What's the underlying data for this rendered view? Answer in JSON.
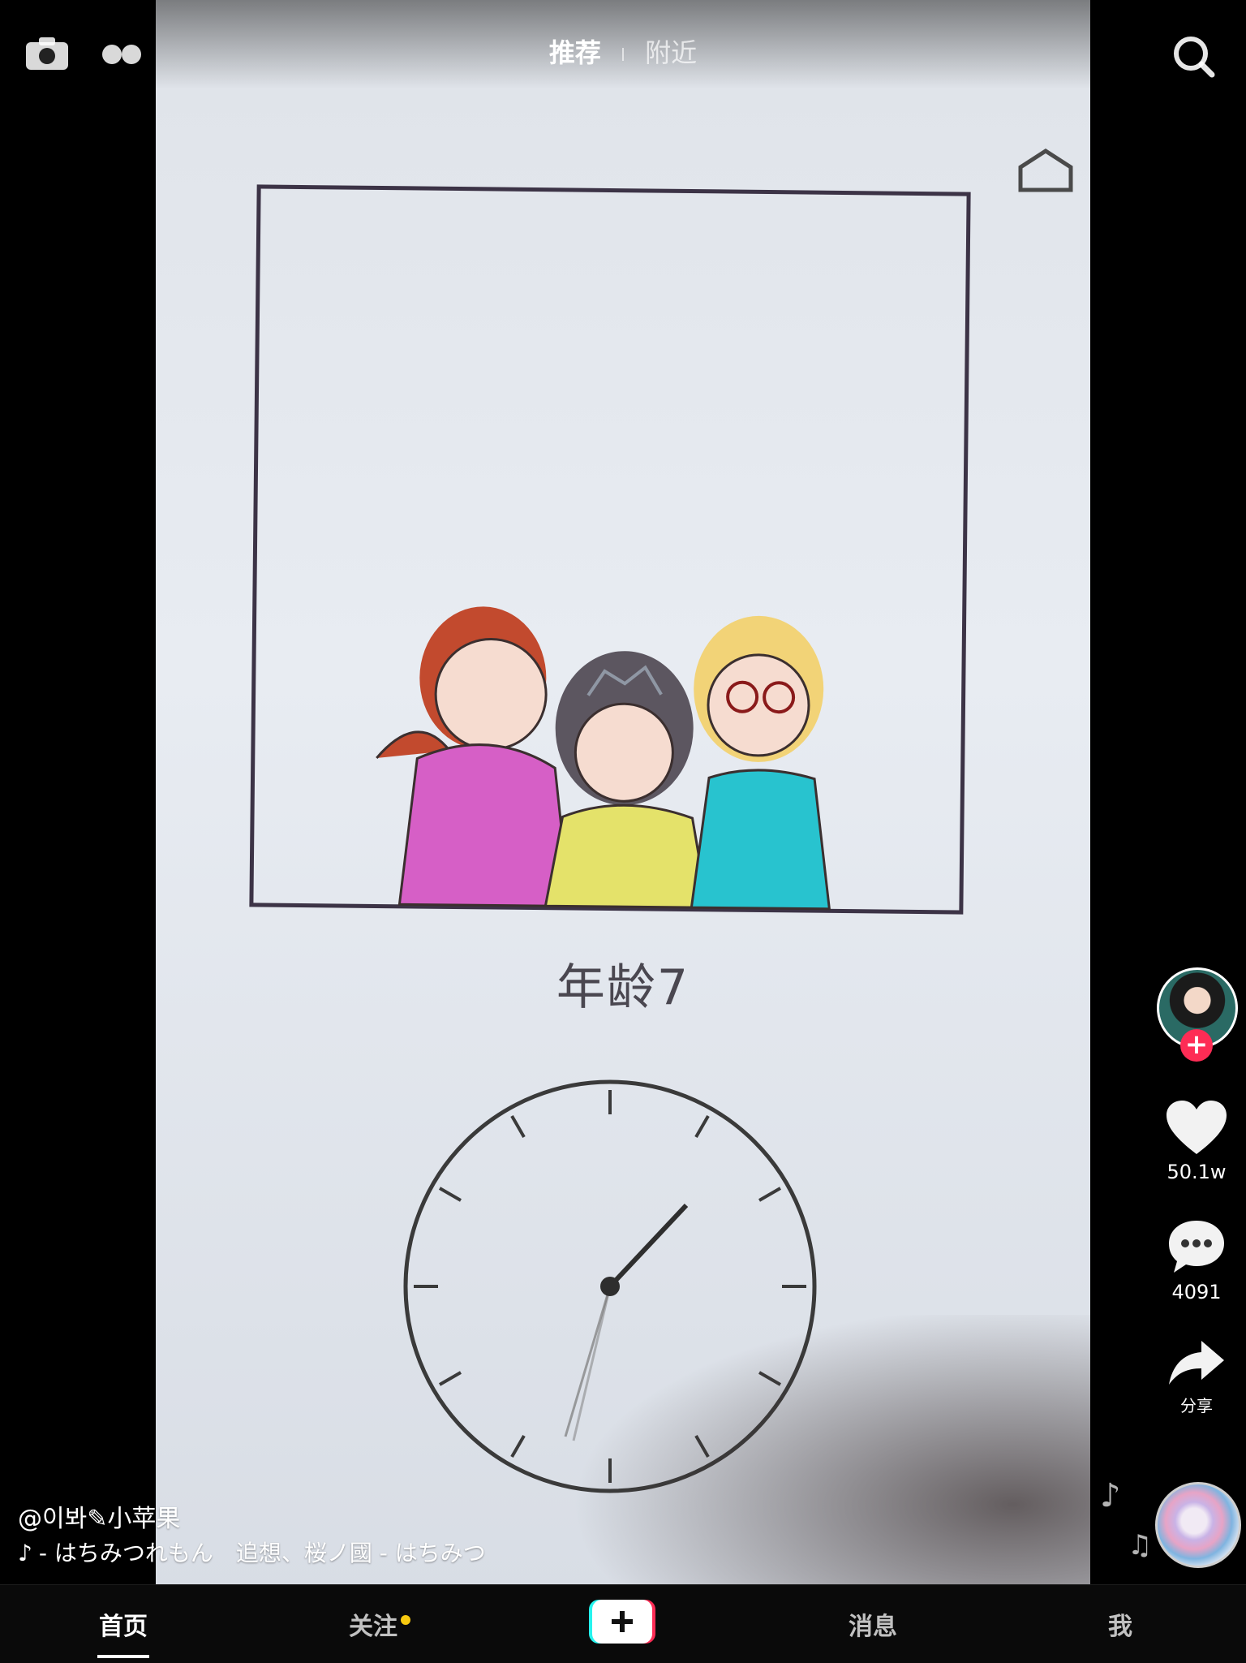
{
  "top": {
    "tab_active": "推荐",
    "tab_inactive": "附近"
  },
  "video": {
    "caption_text": "年龄7"
  },
  "rail": {
    "likes": "50.1w",
    "comments": "4091",
    "share_label": "分享"
  },
  "caption": {
    "author": "@이봐✎小苹果",
    "music": "- はちみつれもん　追想、桜ノ國 - はちみつ"
  },
  "nav": {
    "home": "首页",
    "follow": "关注",
    "messages": "消息",
    "me": "我"
  },
  "colors": {
    "accent_red": "#fe2c55",
    "notify_dot": "#f7c90f",
    "cyan": "#25f4ee"
  },
  "icons": [
    "camera-icon",
    "live-dots-icon",
    "search-icon",
    "heart-icon",
    "comment-icon",
    "share-icon",
    "music-note-icon",
    "plus-icon"
  ]
}
